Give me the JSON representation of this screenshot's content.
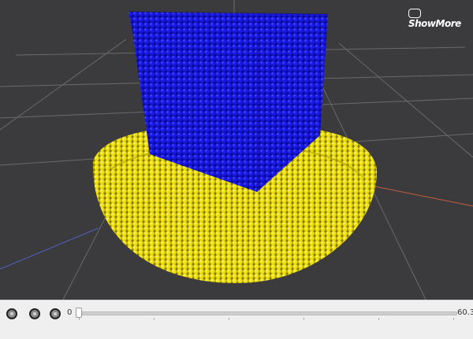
{
  "logo": {
    "text": "ShowMore"
  },
  "scene": {
    "cube_color": "#1010d8",
    "particles_color": "#f2e20a",
    "background": "#3b3a3c"
  },
  "controls": {
    "buttons": [
      {
        "icon": "play-icon"
      },
      {
        "icon": "stop-icon"
      },
      {
        "icon": "record-icon"
      }
    ],
    "slider_min": "0",
    "slider_max": "60.3",
    "slider_value": 0
  }
}
